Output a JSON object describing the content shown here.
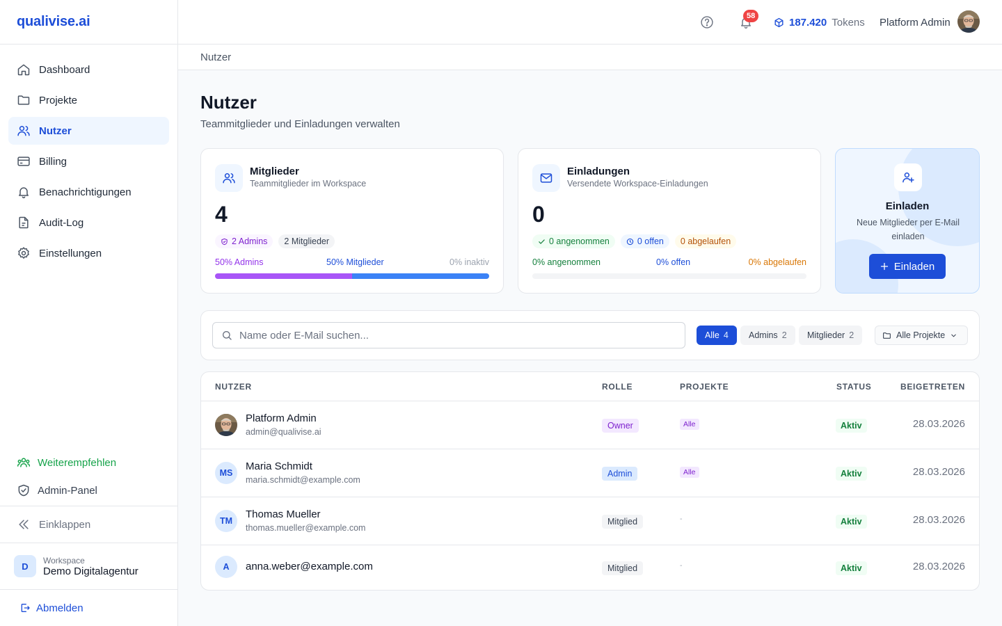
{
  "brand": "qualivise.ai",
  "sidebar": {
    "items": [
      {
        "label": "Dashboard",
        "icon": "home-icon"
      },
      {
        "label": "Projekte",
        "icon": "folder-icon"
      },
      {
        "label": "Nutzer",
        "icon": "users-icon",
        "active": true
      },
      {
        "label": "Billing",
        "icon": "credit-card-icon"
      },
      {
        "label": "Benachrichtigungen",
        "icon": "bell-icon"
      },
      {
        "label": "Audit-Log",
        "icon": "file-text-icon"
      },
      {
        "label": "Einstellungen",
        "icon": "gear-icon"
      }
    ],
    "refer": "Weiterempfehlen",
    "admin_panel": "Admin-Panel",
    "collapse": "Einklappen",
    "workspace_label": "Workspace",
    "workspace_name": "Demo Digitalagentur",
    "workspace_initial": "D",
    "logout": "Abmelden"
  },
  "topbar": {
    "notifications_count": "58",
    "tokens_value": "187.420",
    "tokens_label": "Tokens",
    "user_name": "Platform Admin"
  },
  "breadcrumb": "Nutzer",
  "page": {
    "title": "Nutzer",
    "subtitle": "Teammitglieder und Einladungen verwalten"
  },
  "members_card": {
    "title": "Mitglieder",
    "subtitle": "Teammitglieder im Workspace",
    "count": "4",
    "chip_admins": "2 Admins",
    "chip_members": "2 Mitglieder",
    "pct_admins": "50% Admins",
    "pct_members": "50% Mitglieder",
    "pct_inactive": "0% inaktiv",
    "share_admins": 0.5,
    "share_members": 0.5,
    "share_inactive": 0
  },
  "invites_card": {
    "title": "Einladungen",
    "subtitle": "Versendete Workspace-Einladungen",
    "count": "0",
    "chip_accepted": "0 angenommen",
    "chip_open": "0 offen",
    "chip_expired": "0 abgelaufen",
    "pct_accepted": "0% angenommen",
    "pct_open": "0% offen",
    "pct_expired": "0% abgelaufen"
  },
  "invite_cta": {
    "title": "Einladen",
    "subtitle": "Neue Mitglieder per E-Mail einladen",
    "button": "Einladen"
  },
  "filters": {
    "search_placeholder": "Name oder E-Mail suchen...",
    "tabs": [
      {
        "label": "Alle",
        "count": "4",
        "active": true
      },
      {
        "label": "Admins",
        "count": "2"
      },
      {
        "label": "Mitglieder",
        "count": "2"
      }
    ],
    "project_select": "Alle Projekte"
  },
  "table": {
    "headers": [
      "NUTZER",
      "ROLLE",
      "PROJEKTE",
      "STATUS",
      "BEIGETRETEN"
    ],
    "rows": [
      {
        "initials": "",
        "photo": true,
        "name": "Platform Admin",
        "email": "admin@qualivise.ai",
        "role": "Owner",
        "projects": "Alle",
        "status": "Aktiv",
        "joined": "28.03.2026"
      },
      {
        "initials": "MS",
        "name": "Maria Schmidt",
        "email": "maria.schmidt@example.com",
        "role": "Admin",
        "projects": "Alle",
        "status": "Aktiv",
        "joined": "28.03.2026"
      },
      {
        "initials": "TM",
        "name": "Thomas Mueller",
        "email": "thomas.mueller@example.com",
        "role": "Mitglied",
        "projects": "-",
        "status": "Aktiv",
        "joined": "28.03.2026"
      },
      {
        "initials": "A",
        "name": "anna.weber@example.com",
        "email": "",
        "role": "Mitglied",
        "projects": "-",
        "status": "Aktiv",
        "joined": "28.03.2026"
      }
    ]
  },
  "colors": {
    "accent": "#1d4ed8",
    "admins_bar": "#a855f7",
    "members_bar": "#3b82f6",
    "success": "#16a34a",
    "danger": "#ef4444"
  }
}
